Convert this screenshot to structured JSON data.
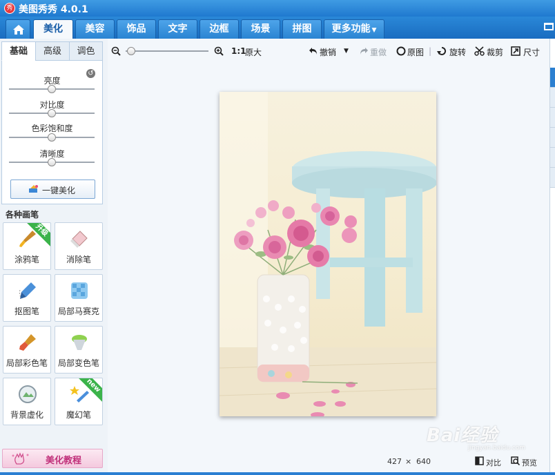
{
  "app": {
    "logo_text": "秀",
    "title": "美图秀秀 4.0.1"
  },
  "tabs": [
    {
      "label": "美化",
      "active": true
    },
    {
      "label": "美容"
    },
    {
      "label": "饰品"
    },
    {
      "label": "文字"
    },
    {
      "label": "边框"
    },
    {
      "label": "场景"
    },
    {
      "label": "拼图"
    },
    {
      "label": "更多功能"
    }
  ],
  "adjust": {
    "subtabs": [
      "基础",
      "高级",
      "调色"
    ],
    "sliders": [
      {
        "label": "亮度",
        "value": 0.5
      },
      {
        "label": "对比度",
        "value": 0.5
      },
      {
        "label": "色彩饱和度",
        "value": 0.5
      },
      {
        "label": "清晰度",
        "value": 0.5
      }
    ],
    "one_click_label": "一键美化"
  },
  "brushes": {
    "title": "各种画笔",
    "items": [
      {
        "label": "涂鸦笔",
        "badge": "升级"
      },
      {
        "label": "消除笔"
      },
      {
        "label": "抠图笔"
      },
      {
        "label": "局部马赛克"
      },
      {
        "label": "局部彩色笔"
      },
      {
        "label": "局部变色笔"
      },
      {
        "label": "背景虚化"
      },
      {
        "label": "魔幻笔",
        "badge": "new"
      }
    ]
  },
  "tutorial_label": "美化教程",
  "toolbar": {
    "zoom_level": 0.02,
    "ratio_label": "1:1",
    "original_size_label": "原大",
    "undo_label": "撤销",
    "redo_label": "重做",
    "original_label": "原图",
    "rotate_label": "旋转",
    "crop_label": "裁剪",
    "size_label": "尺寸"
  },
  "status": {
    "image_width": "427",
    "times": "×",
    "image_height": "640",
    "compare_label": "对比",
    "preview_label": "预览"
  },
  "watermark": {
    "main": "Bai经验",
    "sub": "jingyan.baidu.com"
  },
  "colors": {
    "titlebar": "#1f79cf",
    "accent": "#2b7fd0",
    "tutorial": "#c0307a"
  }
}
